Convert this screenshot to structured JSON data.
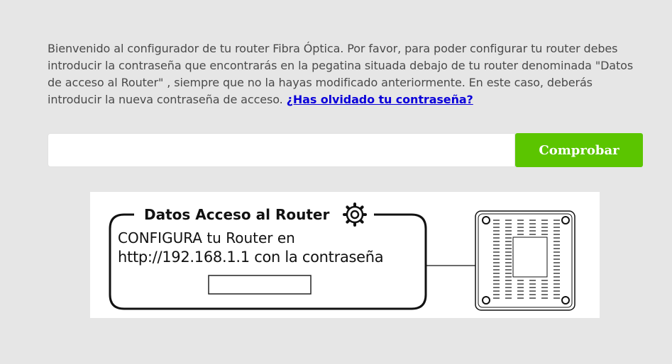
{
  "intro": {
    "text": "Bienvenido al configurador de tu router Fibra Óptica. Por favor, para poder configurar tu router debes introducir la contraseña que encontrarás en la pegatina situada debajo de tu router denominada \"Datos de acceso al Router\" , siempre que no la hayas modificado anteriormente. En este caso, deberás introducir la nueva contraseña de acceso.",
    "forgot_link": "¿Has olvidado tu contraseña?"
  },
  "form": {
    "password_value": "",
    "password_placeholder": "",
    "submit_label": "Comprobar"
  },
  "sticker": {
    "title": "Datos Acceso al Router",
    "line1": "CONFIGURA tu Router en",
    "line2": "http://192.168.1.1 con la contraseña",
    "icon": "gear-icon"
  },
  "colors": {
    "background": "#e6e6e6",
    "button": "#5bc500",
    "link": "#0a00d9"
  }
}
